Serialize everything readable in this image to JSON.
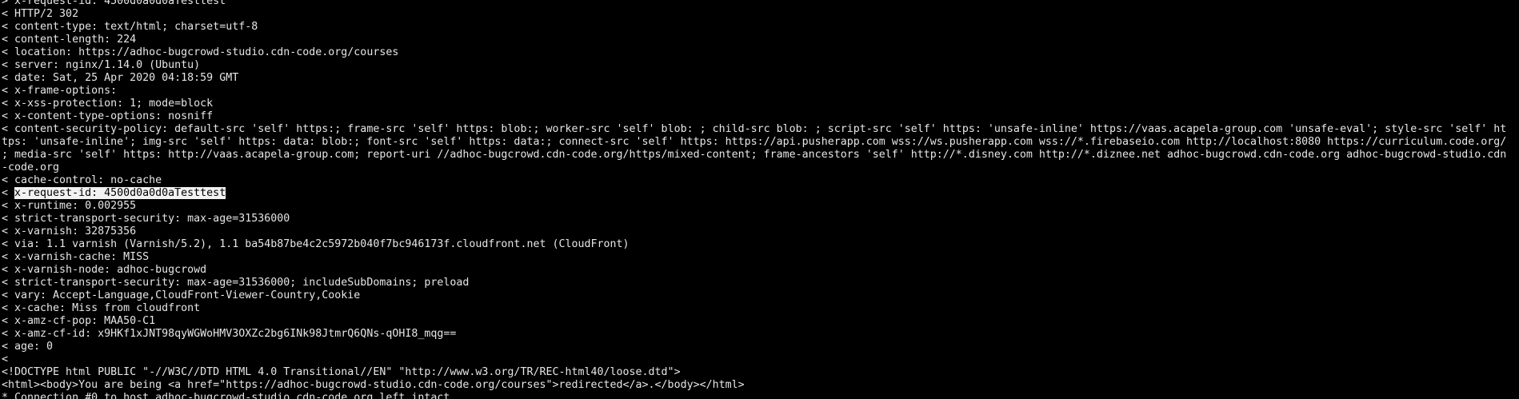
{
  "terminal": {
    "colors": {
      "background": "#000000",
      "foreground": "#e6e6e6",
      "selection_background": "#f2f2f2",
      "selection_foreground": "#000000"
    },
    "partial_top_line": "> x-request-id: 4500d0a0d0aTesttest",
    "lines": [
      {
        "prefix": "< ",
        "text": "HTTP/2 302"
      },
      {
        "prefix": "< ",
        "text": "content-type: text/html; charset=utf-8"
      },
      {
        "prefix": "< ",
        "text": "content-length: 224"
      },
      {
        "prefix": "< ",
        "text": "location: https://adhoc-bugcrowd-studio.cdn-code.org/courses"
      },
      {
        "prefix": "< ",
        "text": "server: nginx/1.14.0 (Ubuntu)"
      },
      {
        "prefix": "< ",
        "text": "date: Sat, 25 Apr 2020 04:18:59 GMT"
      },
      {
        "prefix": "< ",
        "text": "x-frame-options:"
      },
      {
        "prefix": "< ",
        "text": "x-xss-protection: 1; mode=block"
      },
      {
        "prefix": "< ",
        "text": "x-content-type-options: nosniff"
      },
      {
        "prefix": "< ",
        "text": "content-security-policy: default-src 'self' https:; frame-src 'self' https: blob:; worker-src 'self' blob: ; child-src blob: ; script-src 'self' https: 'unsafe-inline' https://vaas.acapela-group.com 'unsafe-eval'; style-src 'self' ht"
      },
      {
        "prefix": "",
        "text": "tps: 'unsafe-inline'; img-src 'self' https: data: blob:; font-src 'self' https: data:; connect-src 'self' https: https://api.pusherapp.com wss://ws.pusherapp.com wss://*.firebaseio.com http://localhost:8080 https://curriculum.code.org/"
      },
      {
        "prefix": "",
        "text": "; media-src 'self' https: http://vaas.acapela-group.com; report-uri //adhoc-bugcrowd.cdn-code.org/https/mixed-content; frame-ancestors 'self' http://*.disney.com http://*.diznee.net adhoc-bugcrowd.cdn-code.org adhoc-bugcrowd-studio.cdn"
      },
      {
        "prefix": "",
        "text": "-code.org"
      },
      {
        "prefix": "< ",
        "text": "cache-control: no-cache"
      },
      {
        "prefix": "< ",
        "text": "x-request-id: 4500d0a0d0aTesttest",
        "selected": true
      },
      {
        "prefix": "< ",
        "text": "x-runtime: 0.002955"
      },
      {
        "prefix": "< ",
        "text": "strict-transport-security: max-age=31536000"
      },
      {
        "prefix": "< ",
        "text": "x-varnish: 32875356"
      },
      {
        "prefix": "< ",
        "text": "via: 1.1 varnish (Varnish/5.2), 1.1 ba54b87be4c2c5972b040f7bc946173f.cloudfront.net (CloudFront)"
      },
      {
        "prefix": "< ",
        "text": "x-varnish-cache: MISS"
      },
      {
        "prefix": "< ",
        "text": "x-varnish-node: adhoc-bugcrowd"
      },
      {
        "prefix": "< ",
        "text": "strict-transport-security: max-age=31536000; includeSubDomains; preload"
      },
      {
        "prefix": "< ",
        "text": "vary: Accept-Language,CloudFront-Viewer-Country,Cookie"
      },
      {
        "prefix": "< ",
        "text": "x-cache: Miss from cloudfront"
      },
      {
        "prefix": "< ",
        "text": "x-amz-cf-pop: MAA50-C1"
      },
      {
        "prefix": "< ",
        "text": "x-amz-cf-id: x9HKf1xJNT98qyWGWoHMV3OXZc2bg6INk98JtmrQ6QNs-qOHI8_mqg=="
      },
      {
        "prefix": "< ",
        "text": "age: 0"
      },
      {
        "prefix": "<",
        "text": ""
      },
      {
        "prefix": "",
        "text": "<!DOCTYPE html PUBLIC \"-//W3C//DTD HTML 4.0 Transitional//EN\" \"http://www.w3.org/TR/REC-html40/loose.dtd\">"
      },
      {
        "prefix": "",
        "text": "<html><body>You are being <a href=\"https://adhoc-bugcrowd-studio.cdn-code.org/courses\">redirected</a>.</body></html>"
      },
      {
        "prefix": "* ",
        "text": "Connection #0 to host adhoc-bugcrowd-studio.cdn-code.org left intact"
      }
    ]
  }
}
